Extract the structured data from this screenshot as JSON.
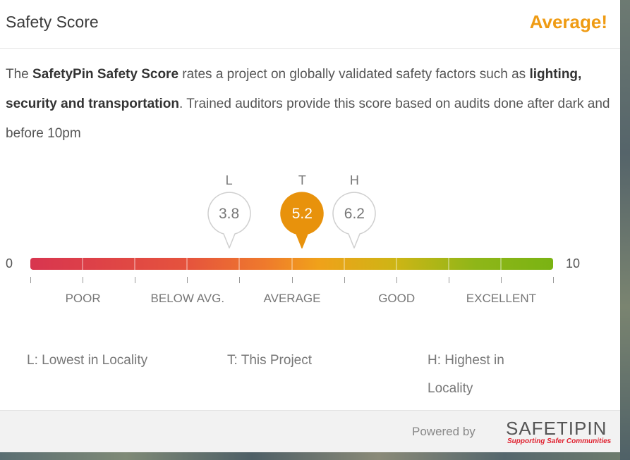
{
  "header": {
    "title": "Safety Score",
    "verdict": "Average!"
  },
  "description": {
    "p1": "The ",
    "brand": "SafetyPin Safety Score",
    "p2": " rates a project on globally validated safety factors such as ",
    "factors": "lighting, security and transportation",
    "p3": ". Trained auditors provide this score based on audits done after dark and before 10pm"
  },
  "scale": {
    "min_label": "0",
    "max_label": "10",
    "min": 0,
    "max": 10
  },
  "markers": [
    {
      "letter": "L",
      "value": "3.8",
      "score": 3.8,
      "active": false
    },
    {
      "letter": "T",
      "value": "5.2",
      "score": 5.2,
      "active": true
    },
    {
      "letter": "H",
      "value": "6.2",
      "score": 6.2,
      "active": false
    }
  ],
  "categories": [
    "POOR",
    "BELOW AVG.",
    "AVERAGE",
    "GOOD",
    "EXCELLENT"
  ],
  "legend": {
    "lowest": "L: Lowest in Locality",
    "this_project": "T: This Project",
    "highest_line1": "H: Highest in",
    "highest_line2": "Locality"
  },
  "footer": {
    "powered_by": "Powered by",
    "logo_name": "SAFETIPIN",
    "tagline": "Supporting Safer Communities"
  },
  "colors": {
    "accent": "#ef9b13",
    "pin_active": "#e8920c",
    "pin_outline": "#cfcfcf",
    "logo_red": "#e0202e"
  }
}
